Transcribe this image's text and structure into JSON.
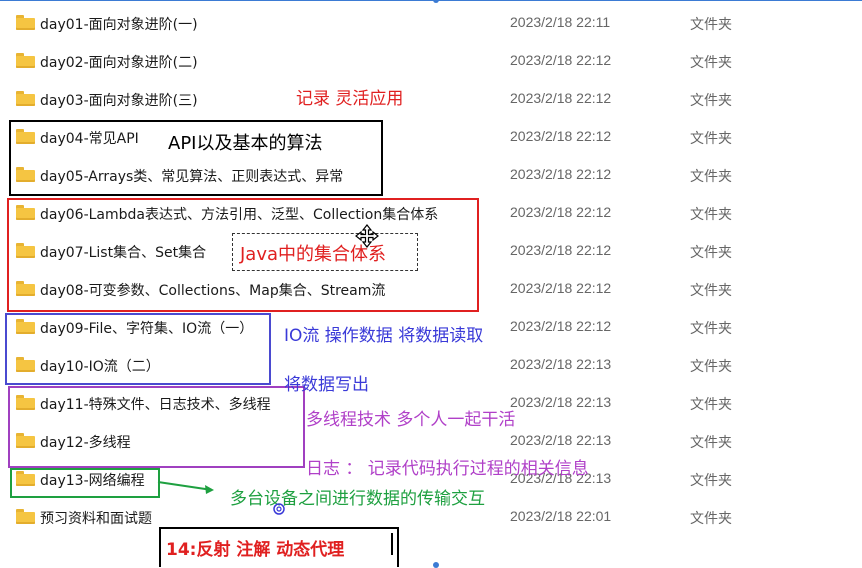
{
  "rows": [
    {
      "name": "day01-面向对象进阶(一)",
      "date": "2023/2/18 22:11",
      "type": "文件夹"
    },
    {
      "name": "day02-面向对象进阶(二)",
      "date": "2023/2/18 22:12",
      "type": "文件夹"
    },
    {
      "name": "day03-面向对象进阶(三)",
      "date": "2023/2/18 22:12",
      "type": "文件夹"
    },
    {
      "name": "day04-常见API",
      "date": "2023/2/18 22:12",
      "type": "文件夹"
    },
    {
      "name": "day05-Arrays类、常见算法、正则表达式、异常",
      "date": "2023/2/18 22:12",
      "type": "文件夹"
    },
    {
      "name": "day06-Lambda表达式、方法引用、泛型、Collection集合体系",
      "date": "2023/2/18 22:12",
      "type": "文件夹"
    },
    {
      "name": "day07-List集合、Set集合",
      "date": "2023/2/18 22:12",
      "type": "文件夹"
    },
    {
      "name": "day08-可变参数、Collections、Map集合、Stream流",
      "date": "2023/2/18 22:12",
      "type": "文件夹"
    },
    {
      "name": "day09-File、字符集、IO流（一）",
      "date": "2023/2/18 22:12",
      "type": "文件夹"
    },
    {
      "name": "day10-IO流（二）",
      "date": "2023/2/18 22:13",
      "type": "文件夹"
    },
    {
      "name": "day11-特殊文件、日志技术、多线程",
      "date": "2023/2/18 22:13",
      "type": "文件夹"
    },
    {
      "name": "day12-多线程",
      "date": "2023/2/18 22:13",
      "type": "文件夹"
    },
    {
      "name": "day13-网络编程",
      "date": "2023/2/18 22:13",
      "type": "文件夹"
    },
    {
      "name": "预习资料和面试题",
      "date": "2023/2/18 22:01",
      "type": "文件夹"
    }
  ],
  "annotations": {
    "record": "记录  灵活应用",
    "api": "API以及基本的算法",
    "java_collections": "Java中的集合体系",
    "io_read": "IO流  操作数据  将数据读取",
    "io_write": "将数据写出",
    "threads": "多线程技术  多个人一起干活",
    "log": "日志 ： 记录代码执行过程的相关信息",
    "network": "多台设备之间进行数据的传输交互",
    "day14": "14:反射  注解  动态代理"
  },
  "colors": {
    "red": "#e02020",
    "black": "#000000",
    "blue": "#4a4ad0",
    "purple": "#a040c0",
    "green": "#1ea040",
    "annot_blue": "#3a3ad8",
    "annot_purple": "#b040c8"
  }
}
